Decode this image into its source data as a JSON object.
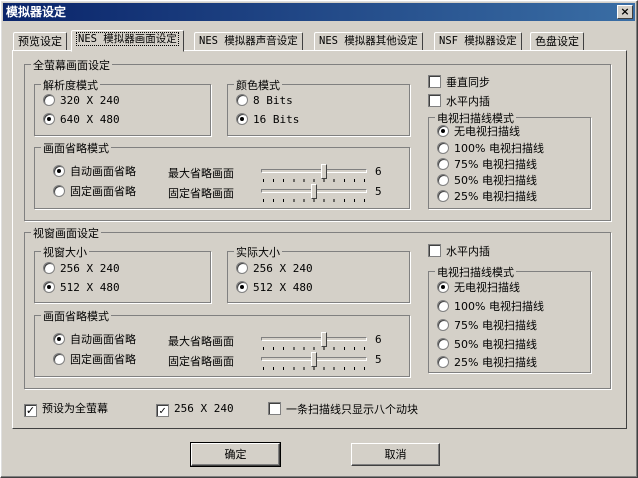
{
  "window": {
    "title": "模拟器设定",
    "close_symbol": "×"
  },
  "tabs": [
    "预览设定",
    "NES 模拟器画面设定",
    "NES 模拟器声音设定",
    "NES 模拟器其他设定",
    "NSF 模拟器设定",
    "色盘设定"
  ],
  "fullscreen": {
    "title": "全萤幕画面设定",
    "resolution": {
      "title": "解析度模式",
      "options": [
        "320 X 240",
        "640 X 480"
      ],
      "selected": 1
    },
    "color": {
      "title": "颜色模式",
      "options": [
        "8 Bits",
        "16 Bits"
      ],
      "selected": 1
    },
    "vsync_label": "垂直同步",
    "interp_label": "水平内插",
    "scanline": {
      "title": "电视扫描线模式",
      "options": [
        "无电视扫描线",
        "100% 电视扫描线",
        "75% 电视扫描线",
        "50% 电视扫描线",
        "25% 电视扫描线"
      ],
      "selected": 0
    },
    "frameskip": {
      "title": "画面省略模式",
      "options": [
        "自动画面省略",
        "固定画面省略"
      ],
      "selected": 0,
      "max_label": "最大省略画面",
      "fixed_label": "固定省略画面",
      "max_value": "6",
      "fixed_value": "5",
      "max_slider": 0.6,
      "fixed_slider": 0.5
    }
  },
  "windowed": {
    "title": "视窗画面设定",
    "window_size": {
      "title": "视窗大小",
      "options": [
        "256 X 240",
        "512 X 480"
      ],
      "selected": 1
    },
    "actual_size": {
      "title": "实际大小",
      "options": [
        "256 X 240",
        "512 X 480"
      ],
      "selected": 1
    },
    "interp_label": "水平内插",
    "scanline": {
      "title": "电视扫描线模式",
      "options": [
        "无电视扫描线",
        "100% 电视扫描线",
        "75% 电视扫描线",
        "50% 电视扫描线",
        "25% 电视扫描线"
      ],
      "selected": 0
    },
    "frameskip": {
      "title": "画面省略模式",
      "options": [
        "自动画面省略",
        "固定画面省略"
      ],
      "selected": 0,
      "max_label": "最大省略画面",
      "fixed_label": "固定省略画面",
      "max_value": "6",
      "fixed_value": "5",
      "max_slider": 0.6,
      "fixed_slider": 0.5
    }
  },
  "bottom": {
    "default_fullscreen": "预设为全萤幕",
    "res_256": "256 X 240",
    "sprite_limit": "一条扫描线只显示八个动块",
    "check_mark": "✓"
  },
  "buttons": {
    "ok": "确定",
    "cancel": "取消"
  }
}
